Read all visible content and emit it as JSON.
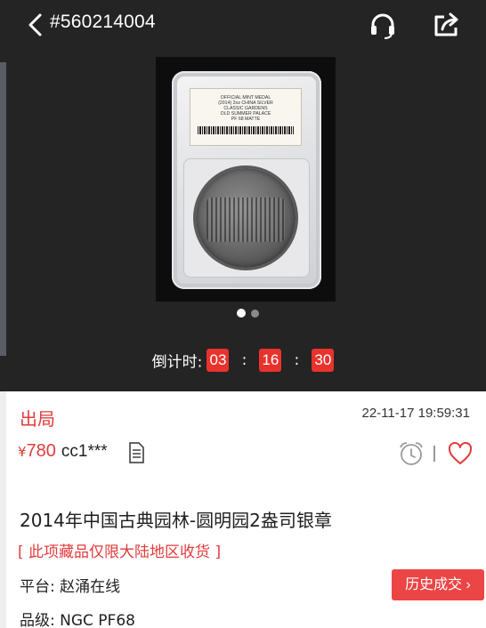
{
  "nav": {
    "title": "#560214004",
    "icons": {
      "back": "chevron-left-icon",
      "service": "headset-icon",
      "share": "share-icon"
    }
  },
  "photo": {
    "label_lines": [
      "OFFICIAL MINT MEDAL",
      "(2014) 2oz CHINA SILVER",
      "CLASSIC GARDENS",
      "OLD SUMMER PALACE",
      "PF 68 MATTE"
    ],
    "carousel": {
      "current": 1,
      "total": 2
    }
  },
  "countdown": {
    "label": "倒计时:",
    "hours": "03",
    "minutes": "16",
    "seconds": "30",
    "separator": ":"
  },
  "auction": {
    "status": "出局",
    "datetime": "22-11-17 19:59:31",
    "currency": "¥",
    "price": "780",
    "bidder": "cc1***"
  },
  "item": {
    "title": "2014年中国古典园林-圆明园2盎司银章",
    "restriction": "[ 此项藏品仅限大陆地区收货 ]",
    "platform": "平台: 赵涌在线",
    "grade": "品级: NGC PF68",
    "history_button": "历史成交 ›"
  },
  "colors": {
    "accent": "#e33b3b",
    "button": "#ec4545",
    "header_bg": "#242424"
  }
}
